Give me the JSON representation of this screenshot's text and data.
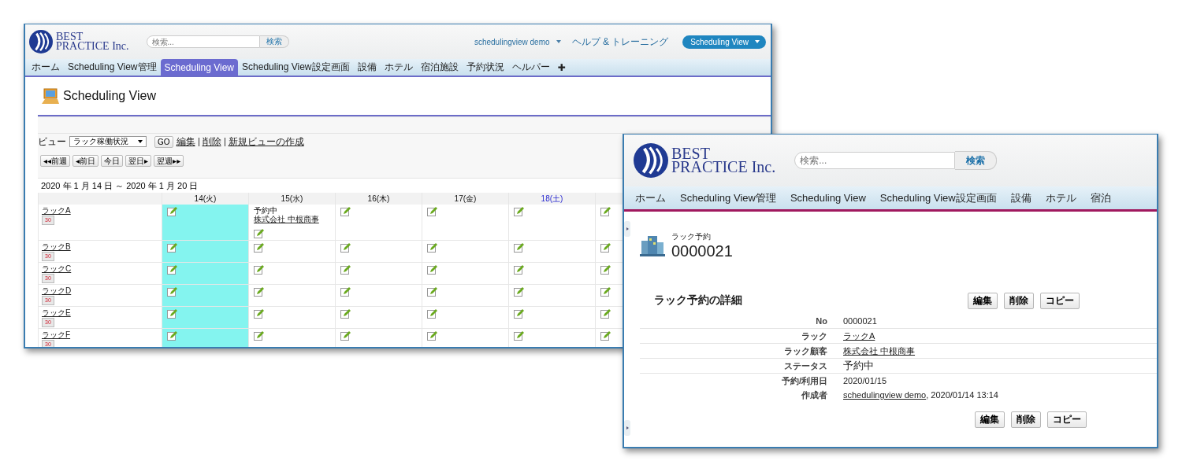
{
  "scheduling_window": {
    "logo": [
      "BEST",
      "PRACTICE Inc."
    ],
    "search": {
      "placeholder": "検索...",
      "button": "検索"
    },
    "user_menu": "schedulingview demo",
    "help_link": "ヘルプ & トレーニング",
    "app_menu": "Scheduling View",
    "tabs": [
      {
        "label": "ホーム",
        "selected": false
      },
      {
        "label": "Scheduling View管理",
        "selected": false
      },
      {
        "label": "Scheduling View",
        "selected": true
      },
      {
        "label": "Scheduling View設定画面",
        "selected": false
      },
      {
        "label": "設備",
        "selected": false
      },
      {
        "label": "ホテル",
        "selected": false
      },
      {
        "label": "宿泊施設",
        "selected": false
      },
      {
        "label": "予約状況",
        "selected": false
      },
      {
        "label": "ヘルパー",
        "selected": false
      },
      {
        "label": "✚",
        "selected": false
      }
    ],
    "page_title": "Scheduling View",
    "view": {
      "label": "ビュー",
      "selected_view": "ラック稼働状況",
      "go_button": "GO",
      "links": [
        "編集",
        "削除",
        "新規ビューの作成"
      ]
    },
    "nav_buttons": [
      "◂◂前週",
      "◂前日",
      "今日",
      "翌日▸",
      "翌週▸▸"
    ],
    "date_range": "2020 年 1 月 14 日 ～ 2020 年 1 月 20 日",
    "table": {
      "columns": [
        {
          "label": "14(火)",
          "kind": "weekday",
          "today": true
        },
        {
          "label": "15(水)",
          "kind": "weekday",
          "today": false
        },
        {
          "label": "16(木)",
          "kind": "weekday",
          "today": false
        },
        {
          "label": "17(金)",
          "kind": "weekday",
          "today": false
        },
        {
          "label": "18(土)",
          "kind": "saturday",
          "today": false
        },
        {
          "kind": "weekday",
          "today": false
        }
      ],
      "rows": [
        {
          "name": "ラックA",
          "calendar": "30",
          "cells": [
            {
              "kind": "empty"
            },
            {
              "kind": "booking",
              "status": "予約中",
              "customer": "株式会社 中根商事"
            },
            {
              "kind": "empty"
            },
            {
              "kind": "empty"
            },
            {
              "kind": "empty"
            },
            {
              "kind": "empty"
            }
          ]
        },
        {
          "name": "ラックB",
          "calendar": "30",
          "cells": [
            {
              "kind": "empty"
            },
            {
              "kind": "empty"
            },
            {
              "kind": "empty"
            },
            {
              "kind": "empty"
            },
            {
              "kind": "empty"
            },
            {
              "kind": "empty"
            }
          ]
        },
        {
          "name": "ラックC",
          "calendar": "30",
          "cells": [
            {
              "kind": "empty"
            },
            {
              "kind": "empty"
            },
            {
              "kind": "empty"
            },
            {
              "kind": "empty"
            },
            {
              "kind": "empty"
            },
            {
              "kind": "empty"
            }
          ]
        },
        {
          "name": "ラックD",
          "calendar": "30",
          "cells": [
            {
              "kind": "empty"
            },
            {
              "kind": "empty"
            },
            {
              "kind": "empty"
            },
            {
              "kind": "empty"
            },
            {
              "kind": "empty"
            },
            {
              "kind": "empty"
            }
          ]
        },
        {
          "name": "ラックE",
          "calendar": "30",
          "cells": [
            {
              "kind": "empty"
            },
            {
              "kind": "empty"
            },
            {
              "kind": "empty"
            },
            {
              "kind": "empty"
            },
            {
              "kind": "empty"
            },
            {
              "kind": "empty"
            }
          ]
        },
        {
          "name": "ラックF",
          "calendar": "30",
          "cells": [
            {
              "kind": "empty"
            },
            {
              "kind": "empty"
            },
            {
              "kind": "empty"
            },
            {
              "kind": "empty"
            },
            {
              "kind": "empty"
            },
            {
              "kind": "empty"
            }
          ]
        }
      ]
    }
  },
  "record_window": {
    "logo": [
      "BEST",
      "PRACTICE Inc."
    ],
    "search": {
      "placeholder": "検索...",
      "button": "検索"
    },
    "tabs": [
      {
        "label": "ホーム",
        "selected": false
      },
      {
        "label": "Scheduling View管理",
        "selected": false
      },
      {
        "label": "Scheduling View",
        "selected": false
      },
      {
        "label": "Scheduling View設定画面",
        "selected": false
      },
      {
        "label": "設備",
        "selected": false
      },
      {
        "label": "ホテル",
        "selected": false
      },
      {
        "label": "宿泊",
        "selected": false
      }
    ],
    "record": {
      "type_label": "ラック予約",
      "number": "0000021"
    },
    "detail": {
      "title": "ラック予約の詳細",
      "buttons": [
        "編集",
        "削除",
        "コピー"
      ],
      "fields": [
        {
          "label": "No",
          "kind": "text",
          "value": "0000021"
        },
        {
          "label": "ラック",
          "kind": "link",
          "value": "ラックA"
        },
        {
          "label": "ラック顧客",
          "kind": "link",
          "value": "株式会社 中根商事"
        },
        {
          "label": "ステータス",
          "kind": "text",
          "value": "予約中"
        },
        {
          "label": "予約/利用日",
          "kind": "text",
          "value": "2020/01/15"
        },
        {
          "label": "作成者",
          "kind": "link_with_text",
          "value": "schedulingview demo",
          "suffix": ", 2020/01/14 13:14"
        }
      ],
      "bottom_buttons": [
        "編集",
        "削除",
        "コピー"
      ]
    }
  }
}
